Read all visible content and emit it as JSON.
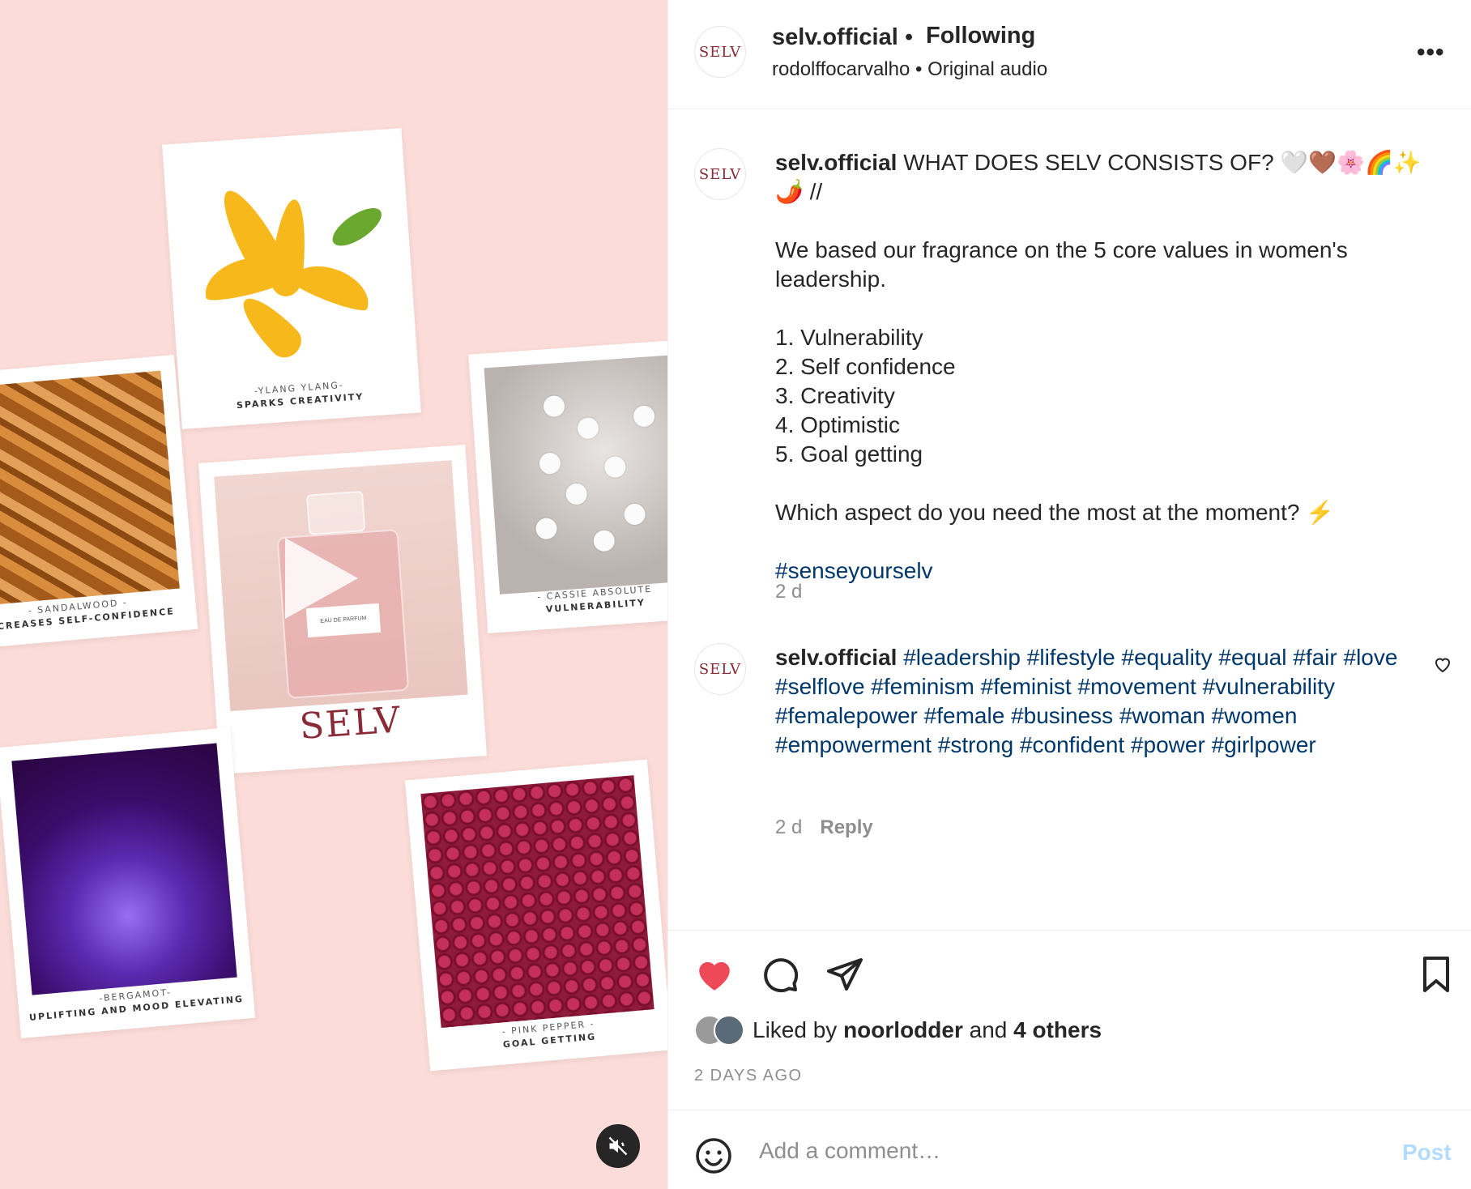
{
  "media": {
    "polaroids": [
      {
        "line1": "-YLANG YLANG-",
        "line2": "SPARKS CREATIVITY"
      },
      {
        "line1": "- SANDALWOOD -",
        "line2": "INCREASES SELF-CONFIDENCE"
      },
      {
        "line1": "- CASSIE ABSOLUTE",
        "line2": "VULNERABILITY"
      },
      {
        "line1": "-BERGAMOT-",
        "line2": "UPLIFTING AND MOOD ELEVATING"
      },
      {
        "line1": "- PINK PEPPER -",
        "line2": "GOAL GETTING"
      }
    ],
    "center": {
      "bottle_brand": "SELV",
      "bottle_label": "EAU DE PARFUM",
      "logo": "SELV"
    }
  },
  "header": {
    "avatar_text": "SELV",
    "username": "selv.official",
    "separator": "•",
    "follow_status": "Following",
    "audio_user": "rodolffocarvalho",
    "audio_sep": "•",
    "audio_label": "Original audio",
    "more": "•••"
  },
  "caption": {
    "avatar_text": "SELV",
    "username": "selv.official",
    "text": " WHAT DOES SELV CONSISTS OF? 🤍🤎🌸🌈✨🌶️ //\n\nWe based our fragrance on the 5 core values in women's leadership.\n\n1. Vulnerability\n2. Self confidence\n3. Creativity\n4. Optimistic\n5. Goal getting\n\nWhich aspect do you need the most at the moment? ⚡\n\n",
    "hashtag": "#senseyourselv",
    "time": "2 d"
  },
  "comment": {
    "avatar_text": "SELV",
    "username": "selv.official",
    "hashtags": [
      "#leadership",
      "#lifestyle",
      "#equality",
      "#equal",
      "#fair",
      "#love",
      "#selflove",
      "#feminism",
      "#feminist",
      "#movement",
      "#vulnerability",
      "#femalepower",
      "#female",
      "#business",
      "#woman",
      "#women",
      "#empowerment",
      "#strong",
      "#confident",
      "#power",
      "#girlpower"
    ],
    "time": "2 d",
    "reply": "Reply"
  },
  "actions": {
    "liked_prefix": "Liked by ",
    "liked_user": "noorlodder",
    "liked_and": " and ",
    "liked_others": "4 others",
    "date": "2 DAYS AGO"
  },
  "add_comment": {
    "placeholder": "Add a comment…",
    "post": "Post"
  },
  "colors": {
    "like_red": "#ed4956",
    "link_blue": "#00376b",
    "post_disabled": "#b3dbff",
    "media_bg": "#fcdcd8"
  }
}
